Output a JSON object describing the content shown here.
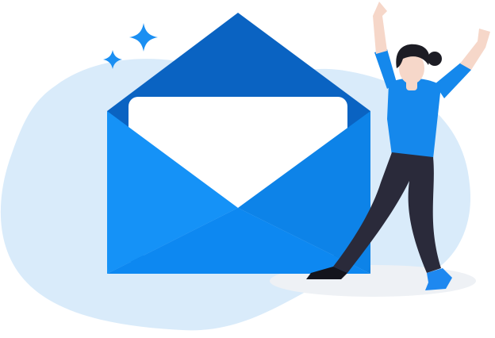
{
  "scene": {
    "subject": "open-envelope-with-celebrating-person",
    "icons": [
      "envelope-icon",
      "letter-card",
      "sparkle-icon",
      "sparkle-icon"
    ]
  },
  "colors": {
    "blob": "#d9ebfa",
    "envelope_back": "#0a63c2",
    "envelope_front": "#0f8cf5",
    "envelope_fold_left": "#1a95f7",
    "envelope_fold_right": "#0d7fe0",
    "envelope_bottom": "#0d86ee",
    "letter": "#ffffff",
    "sparkle": "#1b8ff2",
    "shirt": "#1588ec",
    "pants": "#2a2a3a",
    "skin": "#f6d7c9",
    "hair": "#1c1c24",
    "shoe_blue": "#1e88f0",
    "shoe_dark": "#14141c",
    "shadow": "#eef1f5"
  }
}
